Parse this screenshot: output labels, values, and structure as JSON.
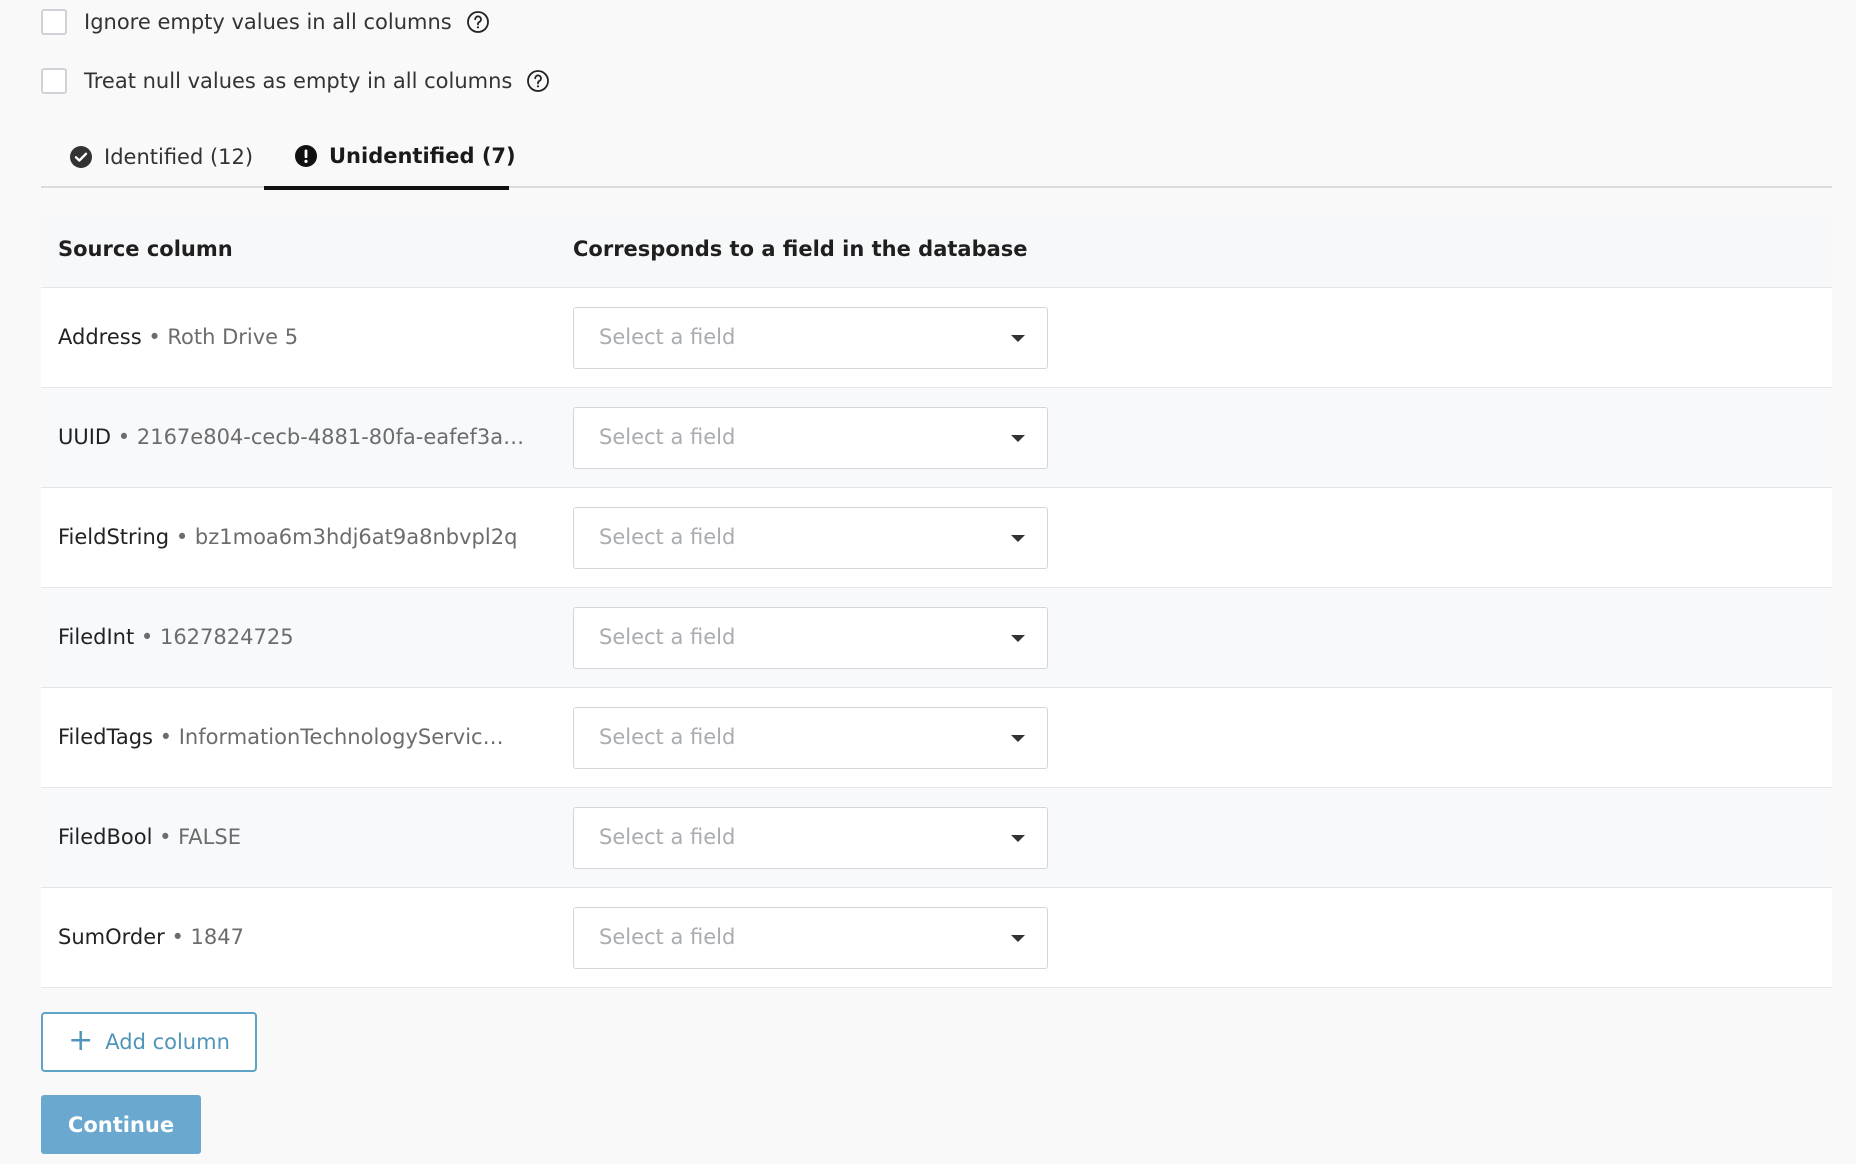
{
  "options": [
    {
      "label": "Ignore empty values in all columns",
      "checked": false,
      "icon": "question-circle-icon"
    },
    {
      "label": "Treat null values as empty in all columns",
      "checked": false,
      "icon": "question-circle-icon"
    }
  ],
  "tabs": [
    {
      "label": "Identified (12)",
      "icon": "check-circle-icon",
      "active": false
    },
    {
      "label": "Unidentified (7)",
      "icon": "exclamation-circle-icon",
      "active": true
    }
  ],
  "table": {
    "headers": {
      "source": "Source column",
      "target": "Corresponds to a field in the database"
    },
    "rows": [
      {
        "name": "Address",
        "sample": " • Roth Drive 5",
        "placeholder": "Select a field"
      },
      {
        "name": "UUID",
        "sample": " • 2167e804-cecb-4881-80fa-eafef3a…",
        "placeholder": "Select a field"
      },
      {
        "name": "FieldString",
        "sample": " • bz1moa6m3hdj6at9a8nbvpl2q",
        "placeholder": "Select a field"
      },
      {
        "name": "FiledInt",
        "sample": " • 1627824725",
        "placeholder": "Select a field"
      },
      {
        "name": "FiledTags",
        "sample": " • InformationTechnologyServic…",
        "placeholder": "Select a field"
      },
      {
        "name": "FiledBool",
        "sample": " • FALSE",
        "placeholder": "Select a field"
      },
      {
        "name": "SumOrder",
        "sample": " • 1847",
        "placeholder": "Select a field"
      }
    ]
  },
  "buttons": {
    "add_column": "Add column",
    "add_column_icon": "plus-icon",
    "continue": "Continue"
  },
  "colors": {
    "accent": "#4f95ba",
    "primary_button": "#6aa8cf",
    "active_tab_underline": "#111111"
  }
}
